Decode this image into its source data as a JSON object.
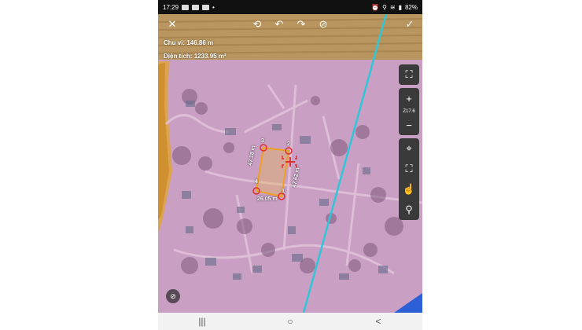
{
  "status_bar": {
    "time": "17:29",
    "dot": "•",
    "battery": "82%",
    "icons": [
      "alarm-icon",
      "location-icon",
      "wifi-icon",
      "signal-icon"
    ]
  },
  "toolbar": {
    "close": "✕",
    "snap": "⟲",
    "undo": "↶",
    "redo": "↷",
    "clear": "⊘",
    "confirm": "✓"
  },
  "measurement": {
    "perimeter_label": "Chu vi:",
    "perimeter_value": "146.86 m",
    "area_label": "Diện tích:",
    "area_value": "1233.95 m²"
  },
  "side_controls": {
    "fullscreen": "⛶",
    "zoom_in": "+",
    "zoom_level": "Z17.6",
    "zoom_out": "−",
    "my_location": "⌖",
    "fit": "⛶",
    "touch": "☝",
    "pin": "⚲"
  },
  "polygon": {
    "points": [
      "1",
      "2",
      "3",
      "4"
    ],
    "edge_bottom": "26.05 m",
    "edge_left": "47.18 m",
    "edge_right": "47.62 m",
    "fill_color": "#e8b64a",
    "stroke_color": "#f0a020",
    "marker_color": "#e03030"
  },
  "map_colors": {
    "base": "#c99fc4",
    "orange_boundary": "#e0a33a",
    "cyan_line": "#2fc6d8",
    "blue_water": "#2d5fd6"
  },
  "hide_button": "⊘",
  "nav_bar": {
    "recents": "|||",
    "home": "○",
    "back": "<"
  }
}
